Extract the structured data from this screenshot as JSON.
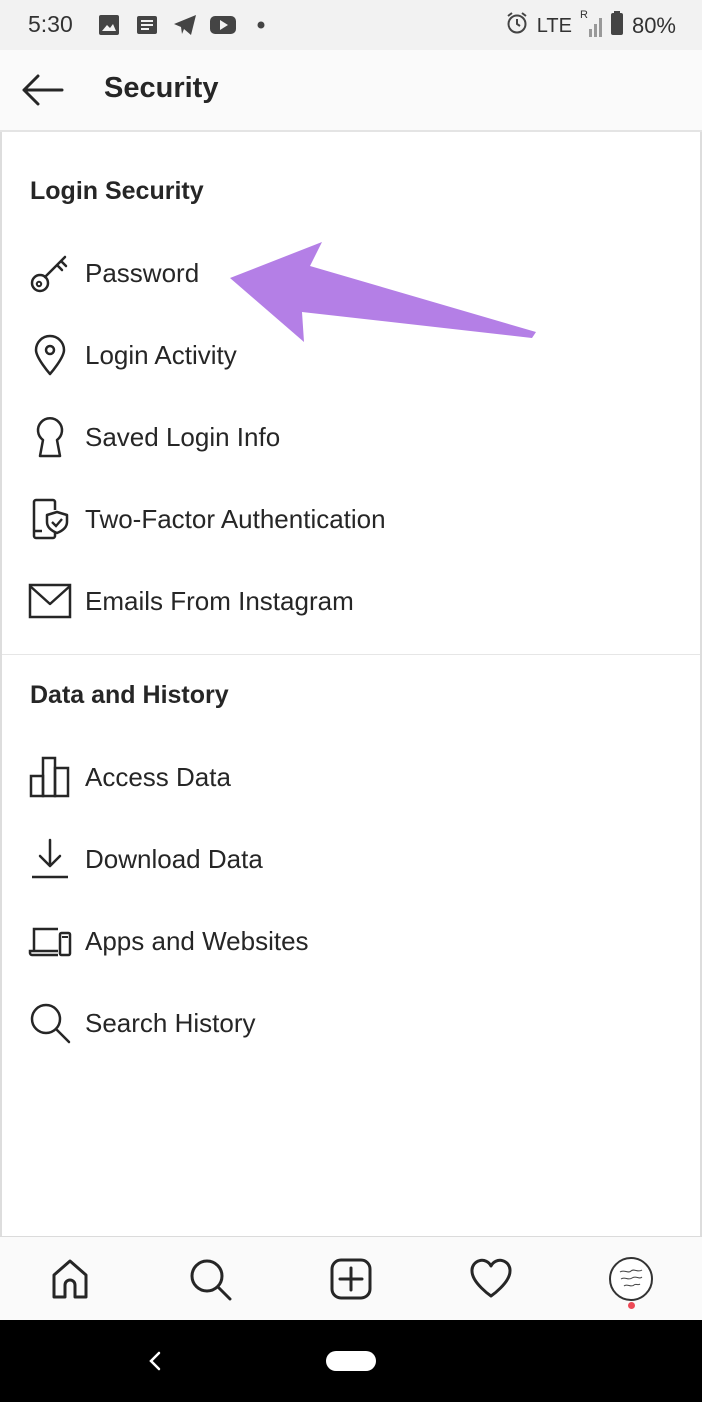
{
  "status_bar": {
    "time": "5:30",
    "network": "LTE",
    "roaming": "R",
    "battery": "80%",
    "left_icons": [
      "image-icon",
      "message-icon",
      "telegram-icon",
      "youtube-icon",
      "dot-icon"
    ]
  },
  "header": {
    "title": "Security"
  },
  "sections": [
    {
      "title": "Login Security",
      "items": [
        {
          "label": "Password",
          "icon": "key-icon"
        },
        {
          "label": "Login Activity",
          "icon": "location-pin-icon"
        },
        {
          "label": "Saved Login Info",
          "icon": "keyhole-icon"
        },
        {
          "label": "Two-Factor Authentication",
          "icon": "phone-shield-icon"
        },
        {
          "label": "Emails From Instagram",
          "icon": "envelope-icon"
        }
      ]
    },
    {
      "title": "Data and History",
      "items": [
        {
          "label": "Access Data",
          "icon": "bar-chart-icon"
        },
        {
          "label": "Download Data",
          "icon": "download-icon"
        },
        {
          "label": "Apps and Websites",
          "icon": "laptop-phone-icon"
        },
        {
          "label": "Search History",
          "icon": "search-icon"
        }
      ]
    }
  ],
  "annotation": {
    "type": "arrow",
    "points_to": "Password",
    "color": "#b47fe6"
  },
  "bottom_nav": [
    "home-icon",
    "search-icon",
    "new-post-icon",
    "heart-icon",
    "profile-avatar"
  ],
  "colors": {
    "text": "#262626",
    "notification": "#ed4956",
    "system_nav": "#000000"
  }
}
